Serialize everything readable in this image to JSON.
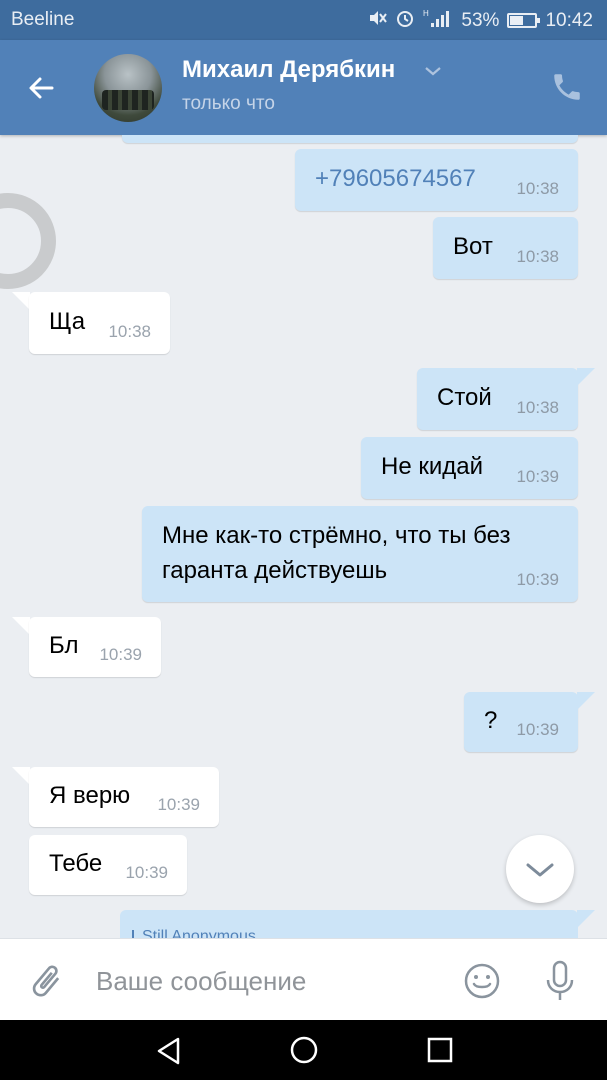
{
  "status_bar": {
    "carrier": "Beeline",
    "network": "H",
    "battery_text": "53%",
    "battery_level": 0.53,
    "time": "10:42"
  },
  "header": {
    "contact_name": "Михаил Дерябкин",
    "status": "только что"
  },
  "messages": [
    {
      "dir": "out",
      "text": "+79605674567",
      "time": "10:38"
    },
    {
      "dir": "out",
      "text": "Вот",
      "time": "10:38"
    },
    {
      "dir": "in",
      "text": "Ща",
      "time": "10:38"
    },
    {
      "dir": "out",
      "text": "Стой",
      "time": "10:38"
    },
    {
      "dir": "out",
      "text": "Не кидай",
      "time": "10:39"
    },
    {
      "dir": "out",
      "text": "Мне как-то стрёмно, что ты без",
      "text2": "гаранта действуешь",
      "time": "10:39"
    },
    {
      "dir": "in",
      "text": "Бл",
      "time": "10:39"
    },
    {
      "dir": "out",
      "text": "?",
      "time": "10:39"
    },
    {
      "dir": "in",
      "text": "Я верю",
      "time": "10:39"
    },
    {
      "dir": "in",
      "text": "Тебе",
      "time": "10:39"
    }
  ],
  "reply_peek": {
    "author": "Still Anonymous"
  },
  "composer": {
    "placeholder": "Ваше сообщение"
  },
  "icons": {
    "back": "arrow-left-icon",
    "call": "phone-icon",
    "attach": "paperclip-icon",
    "emoji": "smiley-icon",
    "mic": "microphone-icon",
    "scroll_down": "chevron-down-icon"
  },
  "colors": {
    "header": "#5181b8",
    "status_bar": "#3e6c9e",
    "outgoing_bubble": "#cce4f7",
    "incoming_bubble": "#ffffff",
    "background": "#ebeef2"
  }
}
